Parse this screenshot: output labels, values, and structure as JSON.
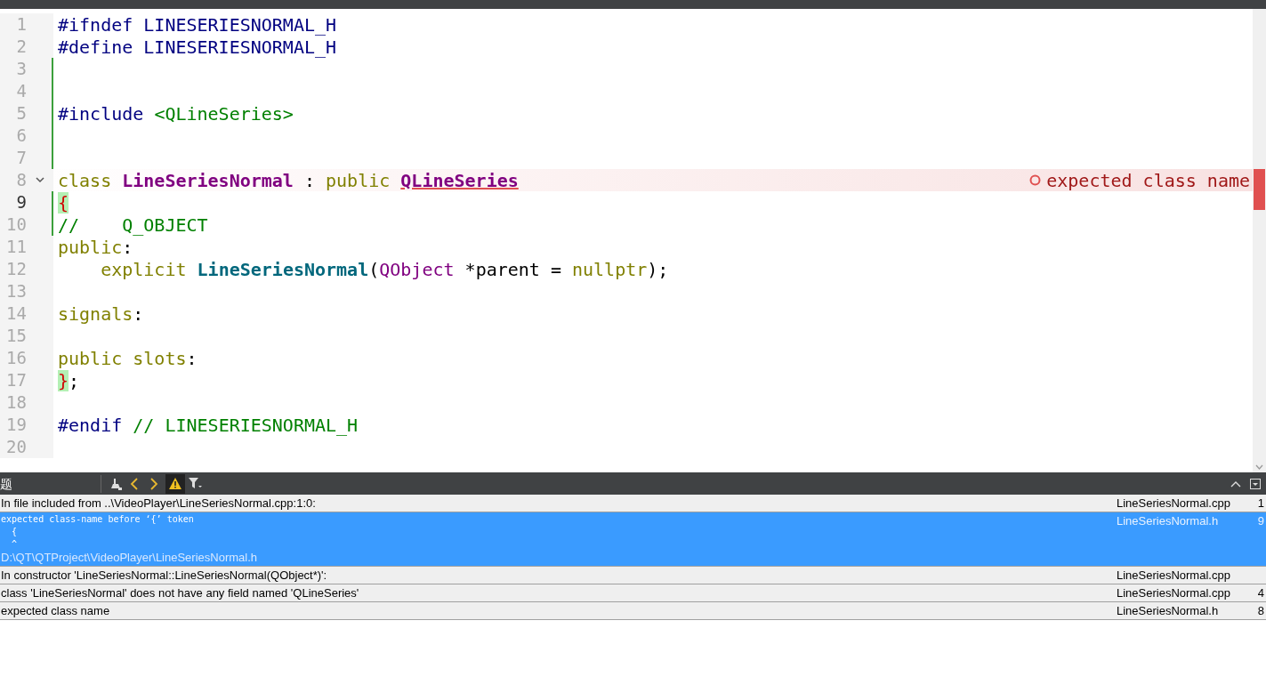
{
  "editor": {
    "lines": [
      {
        "n": "1",
        "tokens": [
          {
            "t": "#ifndef LINESERIESNORMAL_H",
            "kind": "pre"
          }
        ]
      },
      {
        "n": "2",
        "tokens": [
          {
            "t": "#define LINESERIESNORMAL_H",
            "kind": "pre"
          }
        ]
      },
      {
        "n": "3",
        "changed": true
      },
      {
        "n": "4",
        "changed": true
      },
      {
        "n": "5",
        "changed": true,
        "tokens": [
          {
            "t": "#include ",
            "kind": "pre"
          },
          {
            "t": "<QLineSeries>",
            "kind": "str"
          }
        ]
      },
      {
        "n": "6",
        "changed": true
      },
      {
        "n": "7",
        "changed": true
      },
      {
        "n": "8",
        "fold": true,
        "error": "expected class name",
        "tokens": [
          {
            "t": "class ",
            "kind": "kw"
          },
          {
            "t": "LineSeriesNormal",
            "kind": "type"
          },
          {
            "t": " : ",
            "kind": "plain"
          },
          {
            "t": "public ",
            "kind": "kw"
          },
          {
            "t": "QLineSeries",
            "kind": "errtype"
          }
        ]
      },
      {
        "n": "9",
        "current": true,
        "changed": true,
        "tokens": [
          {
            "t": "{",
            "kind": "brace"
          }
        ]
      },
      {
        "n": "10",
        "changed": true,
        "tokens": [
          {
            "t": "//    Q_OBJECT",
            "kind": "comment"
          }
        ]
      },
      {
        "n": "11",
        "tokens": [
          {
            "t": "public",
            "kind": "kw"
          },
          {
            "t": ":",
            "kind": "plain"
          }
        ]
      },
      {
        "n": "12",
        "tokens": [
          {
            "t": "    explicit ",
            "kind": "kw"
          },
          {
            "t": "LineSeriesNormal",
            "kind": "func"
          },
          {
            "t": "(",
            "kind": "plain"
          },
          {
            "t": "QObject",
            "kind": "qtype"
          },
          {
            "t": " *parent = ",
            "kind": "plain"
          },
          {
            "t": "nullptr",
            "kind": "kw"
          },
          {
            "t": ");",
            "kind": "plain"
          }
        ]
      },
      {
        "n": "13"
      },
      {
        "n": "14",
        "tokens": [
          {
            "t": "signals",
            "kind": "kw"
          },
          {
            "t": ":",
            "kind": "plain"
          }
        ]
      },
      {
        "n": "15"
      },
      {
        "n": "16",
        "tokens": [
          {
            "t": "public slots",
            "kind": "kw"
          },
          {
            "t": ":",
            "kind": "plain"
          }
        ]
      },
      {
        "n": "17",
        "tokens": [
          {
            "t": "}",
            "kind": "brace"
          },
          {
            "t": ";",
            "kind": "plain"
          }
        ]
      },
      {
        "n": "18"
      },
      {
        "n": "19",
        "tokens": [
          {
            "t": "#endif ",
            "kind": "pre"
          },
          {
            "t": "// LINESERIESNORMAL_H",
            "kind": "comment"
          }
        ]
      },
      {
        "n": "20"
      }
    ]
  },
  "issues_panel": {
    "title": "题",
    "warnings_filter_on": true,
    "issues": [
      {
        "lines": [
          "In file included from ..\\VideoPlayer\\LineSeriesNormal.cpp:1:0:"
        ],
        "file": "LineSeriesNormal.cpp",
        "line": "1",
        "selected": false
      },
      {
        "lines": [
          "expected class-name before ‘{’ token",
          "  {",
          "  ^"
        ],
        "path": "D:\\QT\\QTProject\\VideoPlayer\\LineSeriesNormal.h",
        "file": "LineSeriesNormal.h",
        "line": "9",
        "selected": true
      },
      {
        "lines": [
          "In constructor 'LineSeriesNormal::LineSeriesNormal(QObject*)':"
        ],
        "file": "LineSeriesNormal.cpp",
        "selected": false
      },
      {
        "lines": [
          "class 'LineSeriesNormal' does not have any field named 'QLineSeries'"
        ],
        "file": "LineSeriesNormal.cpp",
        "line": "4",
        "selected": false
      },
      {
        "lines": [
          "expected class name"
        ],
        "file": "LineSeriesNormal.h",
        "line": "8",
        "selected": false
      }
    ]
  }
}
